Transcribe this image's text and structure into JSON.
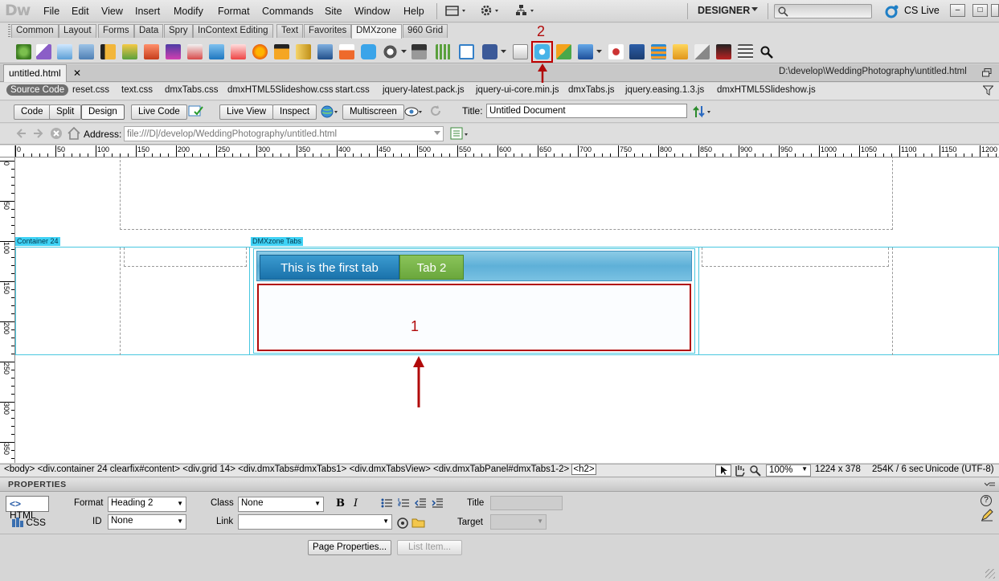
{
  "app": {
    "logo": "Dw",
    "workspace": "DESIGNER",
    "cslive": "CS Live"
  },
  "menu": [
    "File",
    "Edit",
    "View",
    "Insert",
    "Modify",
    "Format",
    "Commands",
    "Site",
    "Window",
    "Help"
  ],
  "insert_tabs": [
    "Common",
    "Layout",
    "Forms",
    "Data",
    "Spry",
    "InContext Editing",
    "Text",
    "Favorites",
    "DMXzone",
    "960 Grid"
  ],
  "active_insert_tab": "DMXzone",
  "document": {
    "tab": "untitled.html",
    "path": "D:\\develop\\WeddingPhotography\\untitled.html"
  },
  "related_files": {
    "source": "Source Code",
    "files": [
      "reset.css",
      "text.css",
      "dmxTabs.css",
      "dmxHTML5Slideshow.css",
      "start.css",
      "jquery-latest.pack.js",
      "jquery-ui-core.min.js",
      "dmxTabs.js",
      "jquery.easing.1.3.js",
      "dmxHTML5Slideshow.js"
    ]
  },
  "doc_toolbar": {
    "code": "Code",
    "split": "Split",
    "design": "Design",
    "live_code": "Live Code",
    "live_view": "Live View",
    "inspect": "Inspect",
    "multiscreen": "Multiscreen",
    "title_label": "Title:",
    "title_value": "Untitled Document"
  },
  "address": {
    "label": "Address:",
    "value": "file:///D|/develop/WeddingPhotography/untitled.html"
  },
  "ruler_h": [
    "0",
    "50",
    "100",
    "150",
    "200",
    "250",
    "300",
    "350",
    "400",
    "450",
    "500",
    "550",
    "600",
    "650",
    "700",
    "750",
    "800",
    "850",
    "900",
    "950",
    "1000",
    "1050",
    "1100",
    "1150",
    "1200"
  ],
  "ruler_v": [
    "0",
    "50",
    "100",
    "150",
    "200",
    "250",
    "300",
    "350"
  ],
  "design": {
    "container_label": "Container 24",
    "tabs_label": "DMXzone Tabs",
    "tab1": "This is the first tab",
    "tab2": "Tab 2"
  },
  "annotations": {
    "one": "1",
    "two": "2"
  },
  "tag_selector": "<body> <div.container  24 clearfix#content> <div.grid  14> <div.dmxTabs#dmxTabs1> <div.dmxTabsView> <div.dmxTabPanel#dmxTabs1-2>",
  "current_tag": "<h2>",
  "status": {
    "zoom": "100%",
    "size": "1224 x 378",
    "download": "254K / 6 sec",
    "encoding": "Unicode (UTF-8)"
  },
  "properties": {
    "title": "PROPERTIES",
    "html": "HTML",
    "css": "CSS",
    "format_label": "Format",
    "format_value": "Heading 2",
    "id_label": "ID",
    "id_value": "None",
    "class_label": "Class",
    "class_value": "None",
    "link_label": "Link",
    "link_value": "",
    "title_label": "Title",
    "target_label": "Target",
    "page_properties": "Page Properties...",
    "list_item": "List Item..."
  },
  "colors": {
    "accent_cyan": "#3ed2f5",
    "annotation_red": "#c00000",
    "tab_blue": "#2a8ac0",
    "tab_green": "#7ab648"
  }
}
